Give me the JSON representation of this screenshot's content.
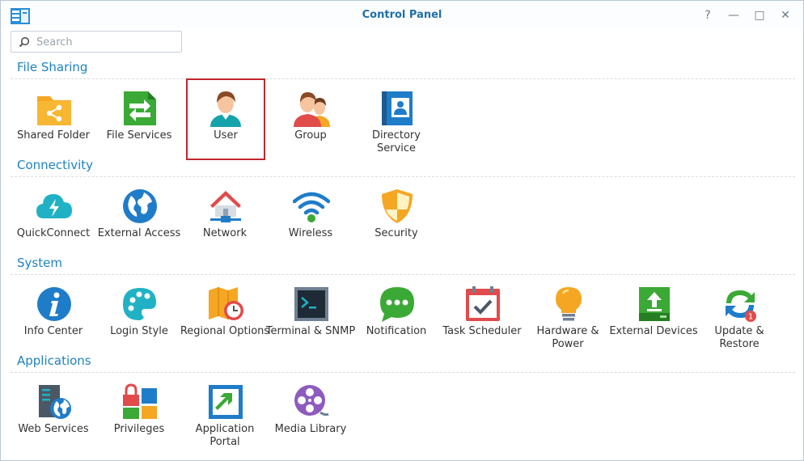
{
  "window": {
    "title": "Control Panel",
    "controls": [
      "?",
      "—",
      "□",
      "✕"
    ]
  },
  "search": {
    "placeholder": "Search"
  },
  "sections": [
    {
      "title": "File Sharing",
      "items": [
        {
          "label": "Shared Folder",
          "icon": "shared-folder-icon"
        },
        {
          "label": "File Services",
          "icon": "file-services-icon"
        },
        {
          "label": "User",
          "icon": "user-icon",
          "selected": true
        },
        {
          "label": "Group",
          "icon": "group-icon"
        },
        {
          "label": "Directory Service",
          "icon": "directory-service-icon"
        }
      ]
    },
    {
      "title": "Connectivity",
      "items": [
        {
          "label": "QuickConnect",
          "icon": "quickconnect-icon"
        },
        {
          "label": "External Access",
          "icon": "external-access-icon"
        },
        {
          "label": "Network",
          "icon": "network-icon"
        },
        {
          "label": "Wireless",
          "icon": "wireless-icon"
        },
        {
          "label": "Security",
          "icon": "security-icon"
        }
      ]
    },
    {
      "title": "System",
      "items": [
        {
          "label": "Info Center",
          "icon": "info-center-icon"
        },
        {
          "label": "Login Style",
          "icon": "login-style-icon"
        },
        {
          "label": "Regional Options",
          "icon": "regional-options-icon"
        },
        {
          "label": "Terminal & SNMP",
          "icon": "terminal-icon"
        },
        {
          "label": "Notification",
          "icon": "notification-icon"
        },
        {
          "label": "Task Scheduler",
          "icon": "task-scheduler-icon"
        },
        {
          "label": "Hardware & Power",
          "icon": "hardware-power-icon"
        },
        {
          "label": "External Devices",
          "icon": "external-devices-icon"
        },
        {
          "label": "Update & Restore",
          "icon": "update-restore-icon",
          "badge": "1"
        }
      ]
    },
    {
      "title": "Applications",
      "items": [
        {
          "label": "Web Services",
          "icon": "web-services-icon"
        },
        {
          "label": "Privileges",
          "icon": "privileges-icon"
        },
        {
          "label": "Application Portal",
          "icon": "application-portal-icon"
        },
        {
          "label": "Media Library",
          "icon": "media-library-icon"
        }
      ]
    }
  ],
  "colors": {
    "accent": "#1f82c0",
    "title": "#1f6fa8",
    "selection": "#c0272d"
  }
}
